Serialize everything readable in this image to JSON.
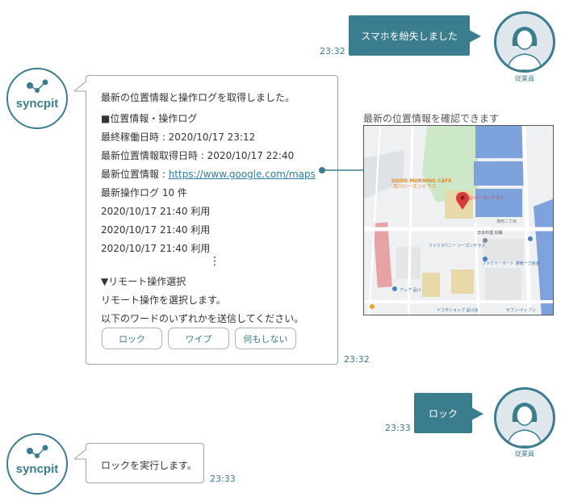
{
  "employee": {
    "caption": "従業員"
  },
  "bot": {
    "name": "syncpit"
  },
  "messages": {
    "m1": {
      "text": "スマホを紛失しました",
      "time": "23:32"
    },
    "m2": {
      "lines": [
        "最新の位置情報と操作ログを取得しました。",
        "■位置情報・操作ログ",
        "最終稼働日時 : 2020/10/17 23:12",
        "最新位置情報取得日時 : 2020/10/17 22:40",
        "最新操作ログ 10 件",
        "2020/10/17 21:40 利用",
        "2020/10/17 21:40 利用",
        "2020/10/17 21:40 利用",
        "▼リモート操作選択",
        "リモート操作を選択します。",
        "以下のワードのいずれかを送信してください。"
      ],
      "location_prefix": "最新位置情報 : ",
      "location_url": "https://www.google.com/maps",
      "ellipsis": "⋮",
      "buttons": [
        "ロック",
        "ワイプ",
        "何もしない"
      ],
      "time": "23:32"
    },
    "m3": {
      "text": "ロック",
      "time": "23:33"
    },
    "m4": {
      "text": "ロックを実行します。",
      "time": "23:33"
    }
  },
  "map": {
    "caption": "最新の位置情報を確認できます",
    "labels": [
      "GOOD MORNING CAFE",
      "品川シーズンテラス",
      "品川シーズンテラス",
      "日本料理 松籟",
      "ファミリーマート 港南一丁目店",
      "ファミマ!!ニー シーズンテラス",
      "アレア 品川",
      "ドコモショップ 品川店",
      "港南二丁目",
      "セブン-イレブン"
    ],
    "colors": {
      "water": "#7ea2dc",
      "park": "#cce8c8",
      "road": "#ffffff",
      "pin": "#d93a3a",
      "rail": "#e7a3a3"
    }
  }
}
